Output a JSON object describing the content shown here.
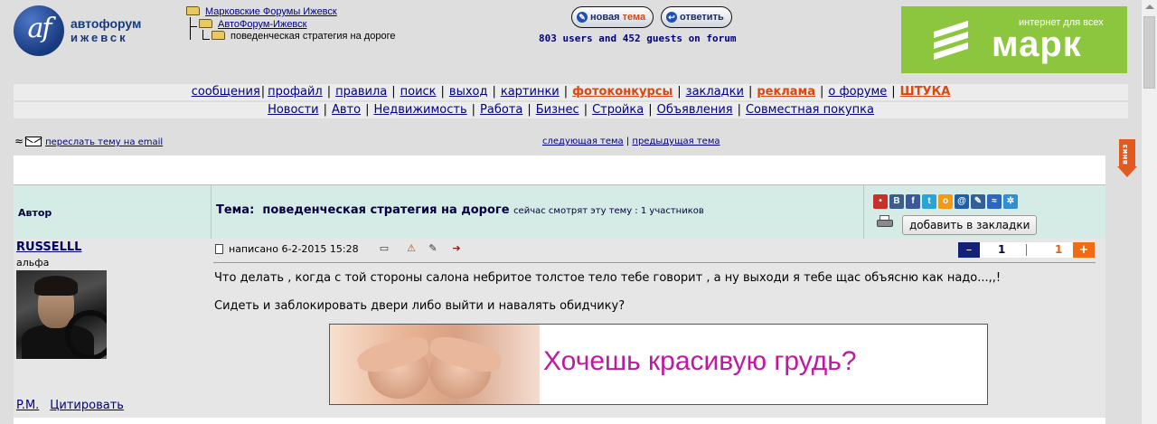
{
  "logo": {
    "mark": "af",
    "line1": "автофорум",
    "line2": "ижевск"
  },
  "breadcrumb": {
    "items": [
      {
        "label": "Марковские Форумы Ижевск"
      },
      {
        "label": "АвтоФорум-Ижевск"
      },
      {
        "label": "поведенческая стратегия на дороге"
      }
    ]
  },
  "top_buttons": {
    "new_topic_a": "новая",
    "new_topic_b": "тема",
    "reply": "ответить"
  },
  "online": "803 users and 452 guests on forum",
  "ad_mark": {
    "tagline": "интернет для всех",
    "brand": "марк"
  },
  "nav1": [
    {
      "label": "сообщения"
    },
    {
      "label": "профайл"
    },
    {
      "label": "правила"
    },
    {
      "label": "поиск"
    },
    {
      "label": "выход"
    },
    {
      "label": "картинки"
    },
    {
      "label": "фотоконкурсы"
    },
    {
      "label": "закладки"
    },
    {
      "label": "реклама"
    },
    {
      "label": "о форуме"
    },
    {
      "label": "ШТУКА"
    }
  ],
  "nav2": [
    {
      "label": "Новости"
    },
    {
      "label": "Авто"
    },
    {
      "label": "Недвижимость"
    },
    {
      "label": "Работа"
    },
    {
      "label": "Бизнес"
    },
    {
      "label": "Стройка"
    },
    {
      "label": "Объявления"
    },
    {
      "label": "Совместная покупка"
    }
  ],
  "tools": {
    "forward": "переслать тему на email",
    "next_topic": "следующая тема",
    "prev_topic": "предыдущая тема",
    "down_tab": "вниз"
  },
  "thead": {
    "author": "Автор",
    "topic_prefix": "Тема:",
    "topic_title": "поведенческая стратегия на дороге",
    "viewers": "сейчас смотрят эту тему : 1 участников",
    "bookmark_button": "добавить в закладки"
  },
  "social_icons": [
    {
      "name": "odnoklassniki-icon",
      "glyph": "•",
      "color": "#c8302a"
    },
    {
      "name": "vkontakte-icon",
      "glyph": "В",
      "color": "#3a5f8f"
    },
    {
      "name": "facebook-icon",
      "glyph": "f",
      "color": "#3b5998"
    },
    {
      "name": "twitter-icon",
      "glyph": "t",
      "color": "#2aa3d8"
    },
    {
      "name": "ok-icon",
      "glyph": "о",
      "color": "#f09a16"
    },
    {
      "name": "mailru-icon",
      "glyph": "@",
      "color": "#1d5fa8"
    },
    {
      "name": "livejournal-icon",
      "glyph": "✎",
      "color": "#345f96"
    },
    {
      "name": "liveinternet-icon",
      "glyph": "≈",
      "color": "#2b66c2"
    },
    {
      "name": "share-icon",
      "glyph": "✲",
      "color": "#2f8fd0"
    }
  ],
  "post": {
    "username": "RUSSELLL",
    "rank": "альфа",
    "posted": "написано 6-2-2015 15:28",
    "vote_minus": "–",
    "vote_down_count": "1",
    "vote_up_count": "1",
    "vote_plus": "+",
    "line1": "Что делать , когда с той стороны салона небритое толстое тело тебе говорит , а ну выходи я тебе щас объясню как надо...,,!",
    "line2": "Сидеть и заблокировать двери либо выйти и навалять обидчику?",
    "pm": "P.M.",
    "quote": "Цитировать"
  },
  "banner": {
    "text": "Хочешь красивую грудь?"
  },
  "colors": {
    "accent": "#d9480f",
    "link": "#000080",
    "header_bg": "#d5ebe6",
    "ad_green": "#8cc63f"
  }
}
